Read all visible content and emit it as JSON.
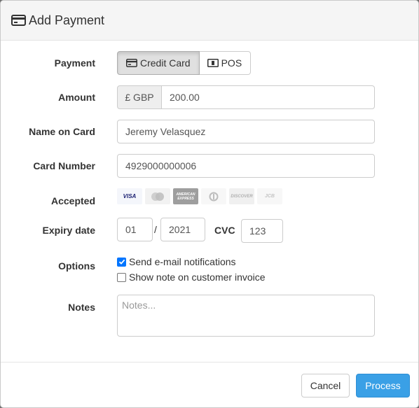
{
  "header": {
    "title": "Add Payment",
    "icon": "credit-card-icon"
  },
  "payment": {
    "label": "Payment",
    "options": [
      {
        "label": "Credit Card",
        "icon": "credit-card-icon",
        "active": true
      },
      {
        "label": "POS",
        "icon": "pos-terminal-icon",
        "active": false
      }
    ]
  },
  "amount": {
    "label": "Amount",
    "currency": "£ GBP",
    "value": "200.00"
  },
  "name_on_card": {
    "label": "Name on Card",
    "value": "Jeremy Velasquez"
  },
  "card_number": {
    "label": "Card Number",
    "value": "4929000000006"
  },
  "accepted": {
    "label": "Accepted",
    "cards": [
      {
        "name": "visa",
        "text": "VISA",
        "color": "#1a1f71",
        "highlighted": true
      },
      {
        "name": "mastercard",
        "text": "",
        "color": "#bdbdbd",
        "highlighted": false
      },
      {
        "name": "american-express",
        "text": "AMERICAN EXPRESS",
        "color": "#9e9e9e",
        "highlighted": false
      },
      {
        "name": "diners-club",
        "text": "",
        "color": "#bdbdbd",
        "highlighted": false
      },
      {
        "name": "discover",
        "text": "DISCOVER",
        "color": "#bdbdbd",
        "highlighted": false
      },
      {
        "name": "jcb",
        "text": "JCB",
        "color": "#bdbdbd",
        "highlighted": false
      }
    ]
  },
  "expiry": {
    "label": "Expiry date",
    "month": "01",
    "separator": "/",
    "year": "2021"
  },
  "cvc": {
    "label": "CVC",
    "value": "123"
  },
  "options": {
    "label": "Options",
    "items": [
      {
        "label": "Send e-mail notifications",
        "checked": true
      },
      {
        "label": "Show note on customer invoice",
        "checked": false
      }
    ]
  },
  "notes": {
    "label": "Notes",
    "placeholder": "Notes...",
    "value": ""
  },
  "footer": {
    "cancel_label": "Cancel",
    "process_label": "Process"
  },
  "colors": {
    "primary": "#3aa0e6",
    "checkbox": "#0075ff",
    "header_bg": "#f5f5f5"
  }
}
